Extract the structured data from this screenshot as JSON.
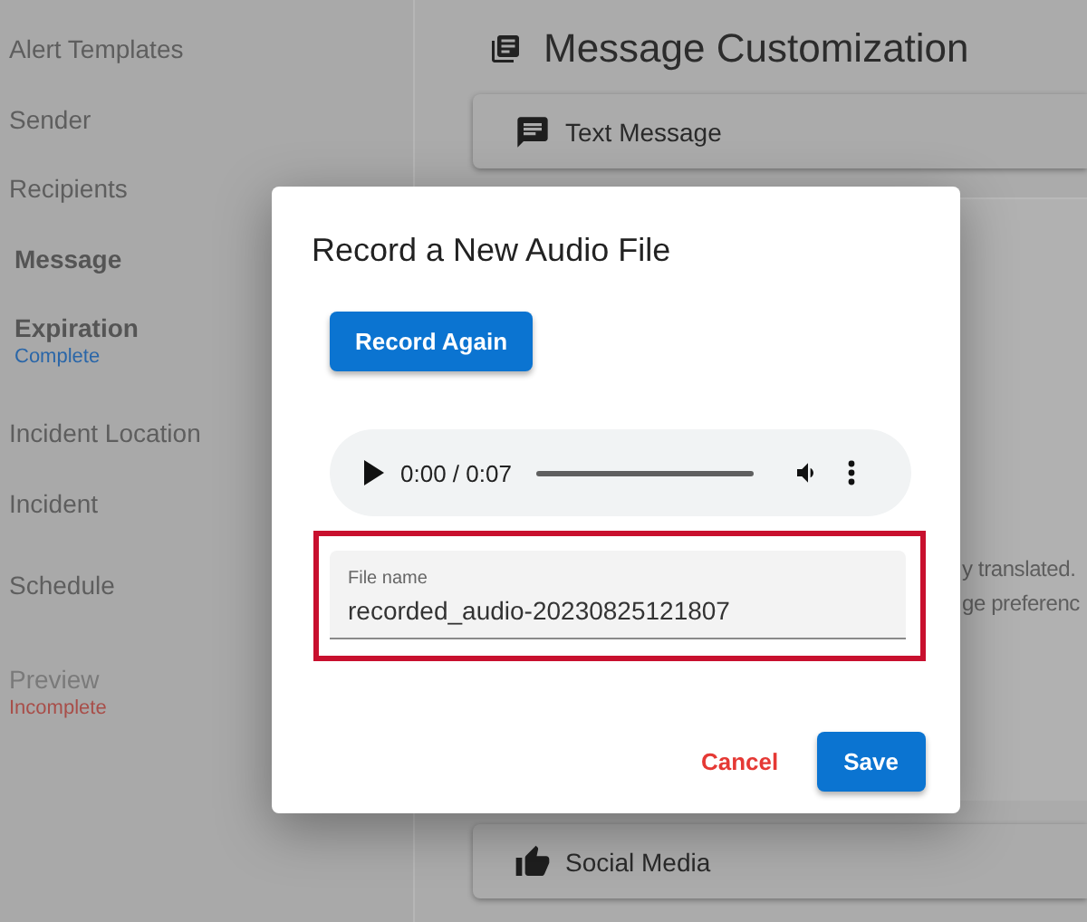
{
  "sidebar": {
    "items": [
      {
        "label": "Alert Templates",
        "highlighted": false,
        "disabled": false
      },
      {
        "label": "Sender",
        "highlighted": false,
        "disabled": false
      },
      {
        "label": "Recipients",
        "highlighted": false,
        "disabled": false
      },
      {
        "label": "Message",
        "highlighted": true,
        "disabled": false
      },
      {
        "label": "Expiration",
        "highlighted": true,
        "disabled": false,
        "status": {
          "text": "Complete",
          "kind": "complete"
        }
      },
      {
        "label": "Incident Location",
        "highlighted": false,
        "disabled": false
      },
      {
        "label": "Incident",
        "highlighted": false,
        "disabled": false
      },
      {
        "label": "Schedule",
        "highlighted": false,
        "disabled": false
      },
      {
        "label": "Preview",
        "highlighted": false,
        "disabled": true,
        "status": {
          "text": "Incomplete",
          "kind": "incomplete"
        }
      }
    ]
  },
  "main": {
    "title": "Message Customization",
    "text_message_card": {
      "label": "Text Message"
    },
    "partial_text_lines": [
      "y translated.",
      "ge preferenc"
    ],
    "social_media_card": {
      "label": "Social Media"
    }
  },
  "dialog": {
    "title": "Record a New Audio File",
    "record_button": "Record Again",
    "audio_player": {
      "time": "0:00 / 0:07",
      "level": 0
    },
    "file_name_field": {
      "label": "File name",
      "value": "recorded_audio-20230825121807",
      "highlighted": true
    },
    "buttons": [
      {
        "label": "Cancel",
        "kind": "text"
      },
      {
        "label": "Save",
        "kind": "primary"
      }
    ]
  }
}
